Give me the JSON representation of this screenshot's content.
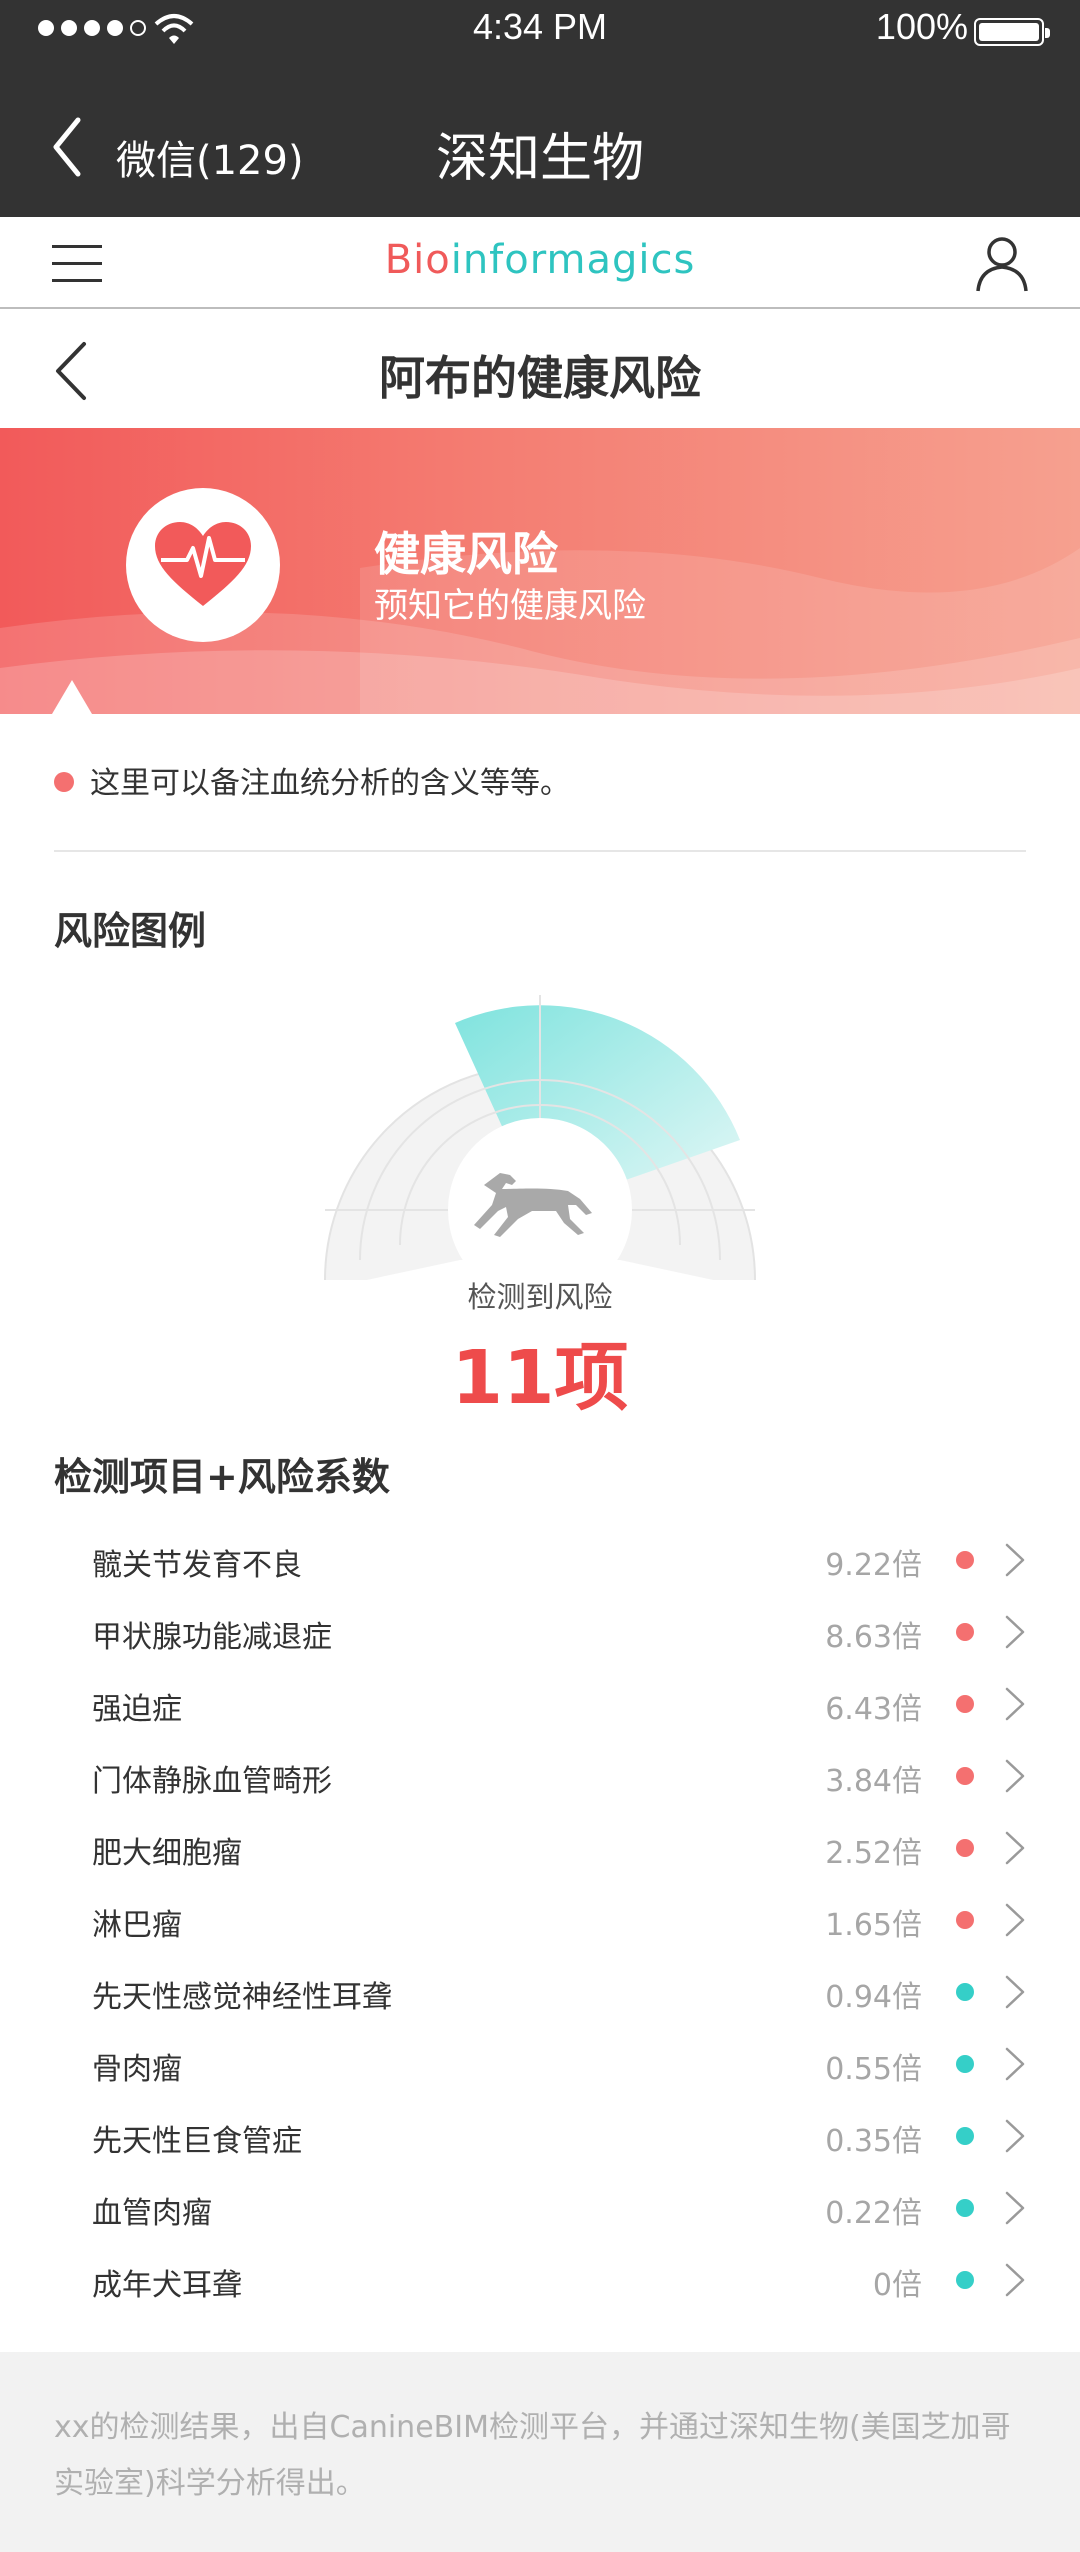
{
  "status_bar": {
    "time": "4:34 PM",
    "battery": "100%",
    "signal_bars_filled": 4,
    "signal_bars_total": 5
  },
  "wechat_nav": {
    "back_label": "微信(129)",
    "title": "深知生物"
  },
  "app_header": {
    "brand_part1": "Bio",
    "brand_part2": "informagics",
    "brand_colors": {
      "part1": "#f05a5a",
      "part2": "#2ec4c0"
    },
    "menu_icon": "hamburger-icon",
    "user_icon": "user-icon"
  },
  "page": {
    "title": "阿布的健康风险",
    "back_icon": "chevron-left-icon"
  },
  "banner": {
    "title": "健康风险",
    "subtitle": "预知它的健康风险",
    "icon": "heart-pulse-icon",
    "colors": {
      "start": "#f25a5a",
      "end": "#f6a08f"
    }
  },
  "note": {
    "text": "这里可以备注血统分析的含义等等。"
  },
  "legend_section": {
    "title": "风险图例",
    "gauge_label": "检测到风险",
    "gauge_count": "11项",
    "center_icon": "dog-running-icon",
    "highlight_color": "#7fe3de"
  },
  "list_section": {
    "title": "检测项目+风险系数",
    "items": [
      {
        "name": "髋关节发育不良",
        "value": "9.22倍",
        "level": "high"
      },
      {
        "name": "甲状腺功能减退症",
        "value": "8.63倍",
        "level": "high"
      },
      {
        "name": "强迫症",
        "value": "6.43倍",
        "level": "high"
      },
      {
        "name": "门体静脉血管畸形",
        "value": "3.84倍",
        "level": "high"
      },
      {
        "name": "肥大细胞瘤",
        "value": "2.52倍",
        "level": "high"
      },
      {
        "name": "淋巴瘤",
        "value": "1.65倍",
        "level": "high"
      },
      {
        "name": "先天性感觉神经性耳聋",
        "value": "0.94倍",
        "level": "low"
      },
      {
        "name": "骨肉瘤",
        "value": "0.55倍",
        "level": "low"
      },
      {
        "name": "先天性巨食管症",
        "value": "0.35倍",
        "level": "low"
      },
      {
        "name": "血管肉瘤",
        "value": "0.22倍",
        "level": "low"
      },
      {
        "name": "成年犬耳聋",
        "value": "0倍",
        "level": "low"
      }
    ],
    "level_colors": {
      "high": "#f47070",
      "low": "#35cfc8"
    }
  },
  "footer": {
    "text": "xx的检测结果，出自CanineBIM检测平台，并通过深知生物(美国芝加哥实验室)科学分析得出。"
  }
}
